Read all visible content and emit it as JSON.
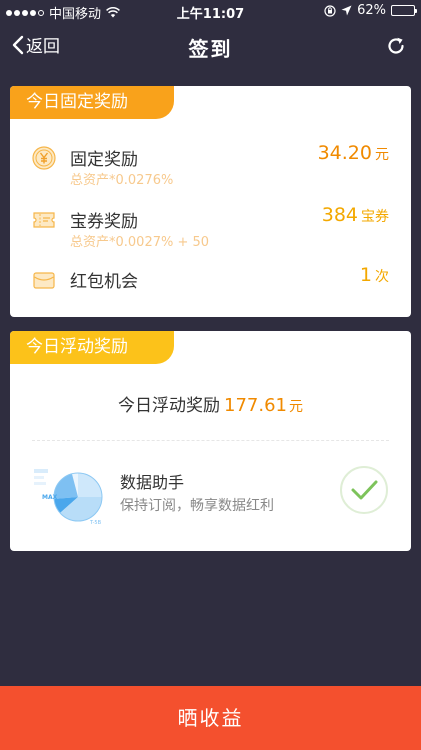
{
  "status_bar": {
    "carrier": "中国移动",
    "time": "上午11:07",
    "battery_text": "62%",
    "battery_level": 0.62
  },
  "nav": {
    "back_label": "返回",
    "title": "签到"
  },
  "fixed_card": {
    "tag": "今日固定奖励",
    "rows": [
      {
        "name": "固定奖励",
        "sub": "总资产*0.0276%",
        "value": "34.20",
        "unit": "元",
        "icon": "yuan-coin-icon"
      },
      {
        "name": "宝券奖励",
        "sub": "总资产*0.0027% + 50",
        "value": "384",
        "unit": "宝券",
        "icon": "ticket-icon"
      },
      {
        "name": "红包机会",
        "sub": "",
        "value": "1",
        "unit": "次",
        "icon": "envelope-icon"
      }
    ]
  },
  "float_card": {
    "tag": "今日浮动奖励",
    "label": "今日浮动奖励",
    "value": "177.61",
    "unit": "元",
    "assistant": {
      "title": "数据助手",
      "subtitle": "保持订阅，畅享数据红利",
      "icon_labels": [
        "MAX",
        "T-5B"
      ]
    }
  },
  "share_button": "晒收益",
  "colors": {
    "background": "#2f2d3f",
    "tag_fixed": "#f9a21b",
    "tag_float": "#fcc21a",
    "value_orange": "#f08a00",
    "share_button": "#f4502e",
    "check_green": "#7dc35b"
  }
}
